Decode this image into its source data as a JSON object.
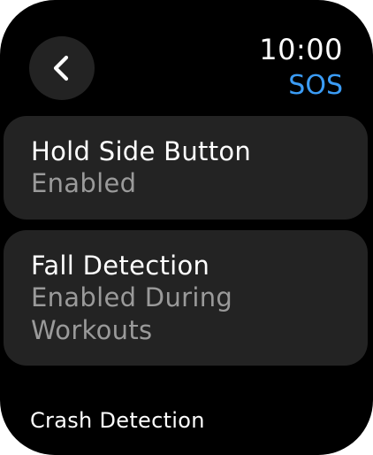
{
  "header": {
    "back_icon": "chevron-left-icon",
    "time": "10:00",
    "title": "SOS",
    "title_color": "#3b9cf5"
  },
  "settings": [
    {
      "title": "Hold Side Button",
      "value": "Enabled"
    },
    {
      "title": "Fall Detection",
      "value": "Enabled During Workouts"
    }
  ],
  "section": {
    "label": "Crash Detection"
  }
}
